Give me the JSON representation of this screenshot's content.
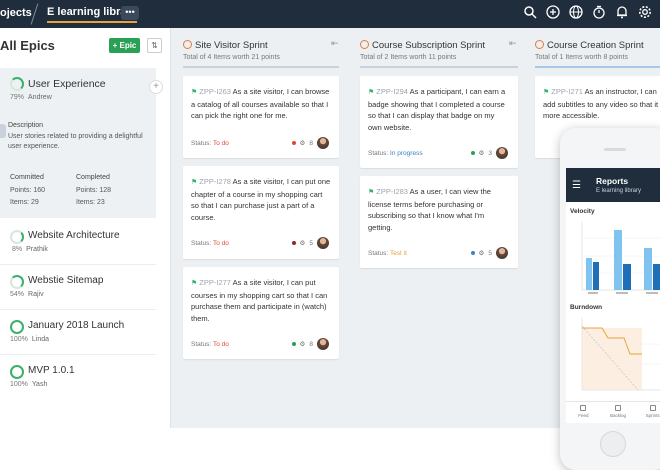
{
  "topbar": {
    "projects_label": "ojects",
    "library_label": "E learning library",
    "more_label": "•••"
  },
  "left": {
    "title": "All Epics",
    "epic_button": "+ Epic",
    "sort_button": "⇅",
    "selected": {
      "title": "User Experience",
      "pct": "79%",
      "owner": "Andrew",
      "desc_label": "Description",
      "desc": "User stories related to providing a delightful user experience.",
      "committed_label": "Committed",
      "completed_label": "Completed",
      "committed_points": "Points:  160",
      "committed_items": "Items:  29",
      "completed_points": "Points:  128",
      "completed_items": "Items:  23"
    },
    "epics": [
      {
        "title": "Website Architecture",
        "pct": "8%",
        "owner": "Prathik"
      },
      {
        "title": "Webstie Sitemap",
        "pct": "54%",
        "owner": "Rajiv"
      },
      {
        "title": "January 2018 Launch",
        "pct": "100%",
        "owner": "Linda"
      },
      {
        "title": "MVP 1.0.1",
        "pct": "100%",
        "owner": "Yash"
      }
    ]
  },
  "columns": [
    {
      "title": "Site Visitor Sprint",
      "sub": "Total of 4 Items worth 21 points",
      "cards": [
        {
          "id": "ZPP-I263",
          "text": "As a site visitor, I can browse a catalog of all courses available so that I can pick the right one for me.",
          "status_label": "Status:",
          "status": "To do",
          "count": "8"
        },
        {
          "id": "ZPP-I278",
          "text": "As a site visitor, I can put one chapter of a course in my shopping cart so that I can purchase just a part of a course.",
          "status_label": "Status:",
          "status": "To do",
          "count": "5"
        },
        {
          "id": "ZPP-I277",
          "text": "As a site visitor, I can put courses in my shopping cart so that I can purchase them and participate in (watch) them.",
          "status_label": "Status:",
          "status": "To do",
          "count": "8"
        }
      ]
    },
    {
      "title": "Course Subscription Sprint",
      "sub": "Total of 2 Items worth 11 points",
      "cards": [
        {
          "id": "ZPP-I294",
          "text": "As a participant, I can earn a badge showing that I completed a course so that I can display that badge on my own website.",
          "status_label": "Status:",
          "status": "In progress",
          "count": "3"
        },
        {
          "id": "ZPP-I283",
          "text": "As a user, I can view the license terms before purchasing or subscribing so that I know what I'm getting.",
          "status_label": "Status:",
          "status": "Test it",
          "count": "5"
        }
      ]
    },
    {
      "title": "Course Creation Sprint",
      "sub": "Total of 1 Items worth 8 points",
      "cards": [
        {
          "id": "ZPP-I271",
          "text": "As an instructor, I can add subtitles to any video so that it is more accessible.",
          "status_label": "Status:",
          "status": "",
          "count": ""
        }
      ]
    }
  ],
  "phone": {
    "title": "Reports",
    "subtitle": "E learning library",
    "velocity_label": "Velocity",
    "burndown_label": "Burndown",
    "nav": [
      "Feed",
      "Backlog",
      "Sprints"
    ]
  },
  "colors": {
    "topbar": "#1f2d3d",
    "green": "#2aa057",
    "todo": "#e0473a",
    "in_progress": "#3b82c4",
    "test": "#e8a33c"
  }
}
